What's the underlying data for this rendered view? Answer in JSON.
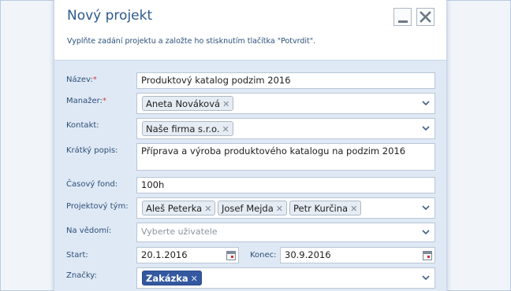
{
  "dialog": {
    "title": "Nový projekt",
    "subtitle": "Vyplňte zadání projektu a založte ho stisknutím tlačítka \"Potvrdit\".",
    "minimize_icon": "minimize-icon",
    "close_icon": "close-icon"
  },
  "form": {
    "name": {
      "label": "Název:",
      "required": "*",
      "value": "Produktový katalog podzim 2016"
    },
    "manager": {
      "label": "Manažer:",
      "required": "*",
      "tags": [
        "Aneta Nováková"
      ]
    },
    "contact": {
      "label": "Kontakt:",
      "tags": [
        "Naše firma s.r.o."
      ]
    },
    "description": {
      "label": "Krátký popis:",
      "value": "Příprava a výroba produktového katalogu na podzim 2016"
    },
    "time_budget": {
      "label": "Časový fond:",
      "value": "100h"
    },
    "team": {
      "label": "Projektový tým:",
      "tags": [
        "Aleš Peterka",
        "Josef Mejda",
        "Petr Kurčina"
      ]
    },
    "cc": {
      "label": "Na vědomí:",
      "placeholder": "Vyberte uživatele"
    },
    "start": {
      "label": "Start:",
      "value": "20.1.2016"
    },
    "end": {
      "label": "Konec:",
      "value": "30.9.2016"
    },
    "tags": {
      "label": "Značky:",
      "tags": [
        "Zakázka"
      ],
      "tag_color": "#3358a0"
    },
    "tag_remove_glyph": "✕",
    "accent_color": "#2c5a8c",
    "required_color": "#d63a3a"
  }
}
